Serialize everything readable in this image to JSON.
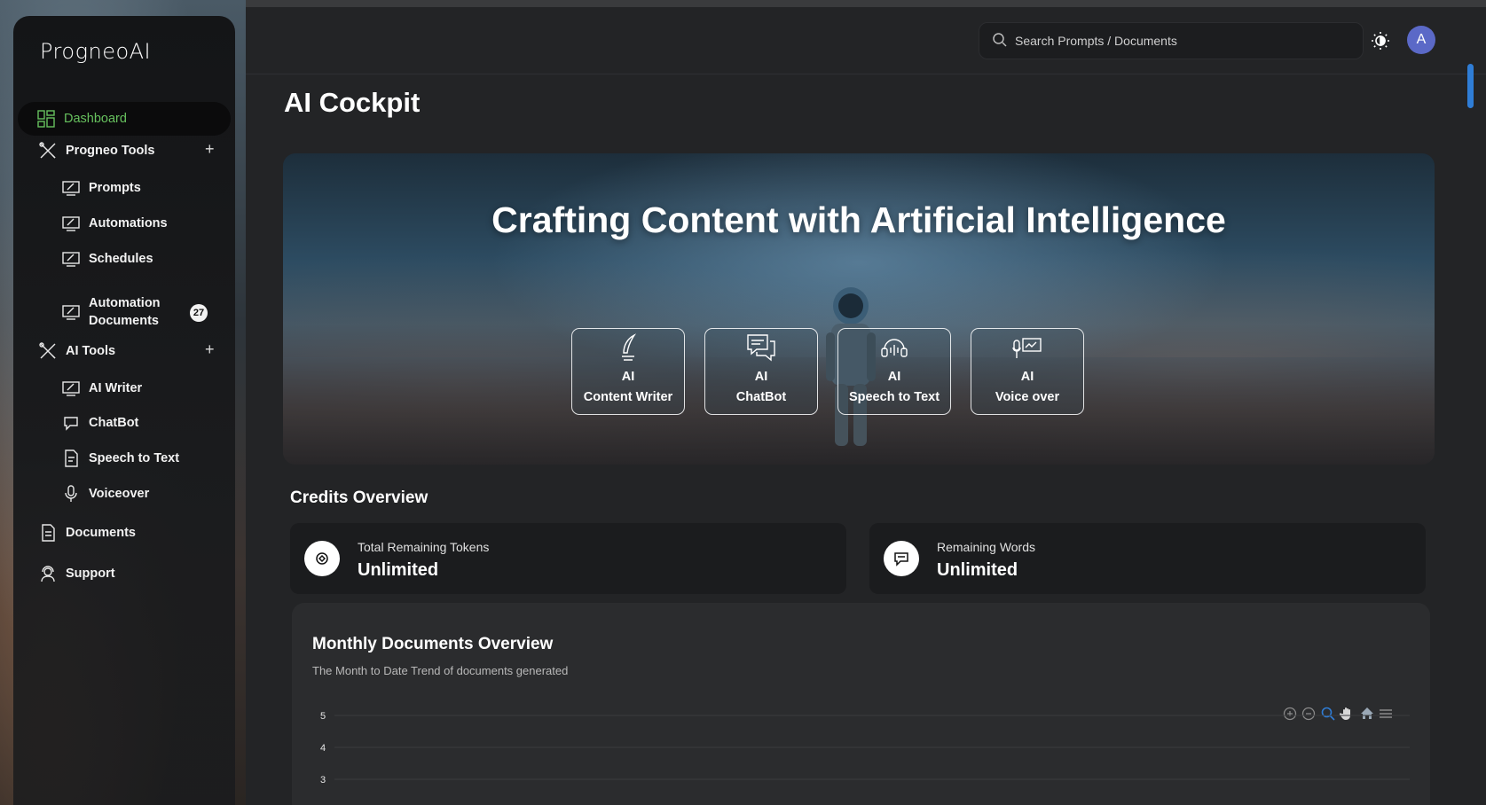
{
  "app": {
    "logo": "ProgneoAI"
  },
  "sidebar": {
    "dashboard": "Dashboard",
    "progneo_tools": "Progneo Tools",
    "prompts": "Prompts",
    "automations": "Automations",
    "schedules": "Schedules",
    "automation_documents_line1": "Automation",
    "automation_documents_line2": "Documents",
    "automation_documents_badge": "27",
    "ai_tools": "AI Tools",
    "ai_writer": "AI Writer",
    "chatbot": "ChatBot",
    "speech_to_text": "Speech to Text",
    "voiceover": "Voiceover",
    "documents": "Documents",
    "support": "Support",
    "expand_symbol": "+"
  },
  "header": {
    "search_placeholder": "Search Prompts / Documents",
    "avatar_initial": "A"
  },
  "main": {
    "page_title": "AI Cockpit",
    "hero_title": "Crafting Content with Artificial Intelligence",
    "tools": [
      {
        "line1": "AI",
        "line2": "Content Writer"
      },
      {
        "line1": "AI",
        "line2": "ChatBot"
      },
      {
        "line1": "AI",
        "line2": "Speech to Text"
      },
      {
        "line1": "AI",
        "line2": "Voice over"
      }
    ],
    "credits_title": "Credits Overview",
    "credits": [
      {
        "label": "Total Remaining Tokens",
        "value": "Unlimited"
      },
      {
        "label": "Remaining Words",
        "value": "Unlimited"
      }
    ],
    "chart_title": "Monthly Documents Overview",
    "chart_subtitle": "The Month to Date Trend of documents generated"
  },
  "chart_data": {
    "type": "line",
    "title": "Monthly Documents Overview",
    "subtitle": "The Month to Date Trend of documents generated",
    "y_ticks": [
      "5",
      "4",
      "3"
    ],
    "ylim": [
      0,
      5
    ],
    "grid": true
  },
  "colors": {
    "accent_green": "#67c15e",
    "avatar_blue": "#5b69c7",
    "scroll_blue": "#2f7dd6"
  }
}
